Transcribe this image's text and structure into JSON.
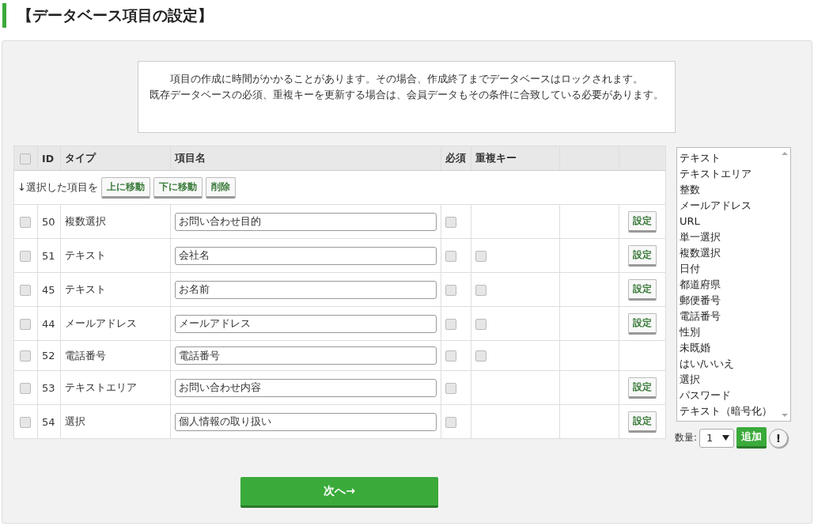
{
  "title": "【データベース項目の設定】",
  "notice": [
    "項目の作成に時間がかかることがあります。その場合、作成終了までデータベースはロックされます。",
    "既存データベースの必須、重複キーを更新する場合は、会員データもその条件に合致している必要があります。"
  ],
  "table": {
    "select_all": {
      "checked": false
    },
    "columns": [
      "ID",
      "タイプ",
      "項目名",
      "必須",
      "重複キー"
    ],
    "action_label": "↓選択した項目を",
    "actions": [
      "上に移動",
      "下に移動",
      "削除"
    ],
    "rows": [
      {
        "checked": false,
        "id": "50",
        "type": "複数選択",
        "name": "お問い合わせ目的",
        "required": false,
        "unique_key": null,
        "settings": "設定"
      },
      {
        "checked": false,
        "id": "51",
        "type": "テキスト",
        "name": "会社名",
        "required": false,
        "unique_key": false,
        "settings": "設定"
      },
      {
        "checked": false,
        "id": "45",
        "type": "テキスト",
        "name": "お名前",
        "required": false,
        "unique_key": false,
        "settings": "設定"
      },
      {
        "checked": false,
        "id": "44",
        "type": "メールアドレス",
        "name": "メールアドレス",
        "required": false,
        "unique_key": false,
        "settings": "設定"
      },
      {
        "checked": false,
        "id": "52",
        "type": "電話番号",
        "name": "電話番号",
        "required": false,
        "unique_key": false
      },
      {
        "checked": false,
        "id": "53",
        "type": "テキストエリア",
        "name": "お問い合わせ内容",
        "required": false,
        "unique_key": null,
        "settings": "設定"
      },
      {
        "checked": false,
        "id": "54",
        "type": "選択",
        "name": "個人情報の取り扱い",
        "required": false,
        "unique_key": null,
        "settings": "設定"
      }
    ]
  },
  "type_list": [
    "テキスト",
    "テキストエリア",
    "整数",
    "メールアドレス",
    "URL",
    "単一選択",
    "複数選択",
    "日付",
    "都道府県",
    "郵便番号",
    "電話番号",
    "性別",
    "未既婚",
    "はい/いいえ",
    "選択",
    "パスワード",
    "テキスト（暗号化）"
  ],
  "quantity": {
    "label": "数量:",
    "value": "1"
  },
  "add_button": "追加",
  "help_button": "!",
  "next_button": "次へ→"
}
